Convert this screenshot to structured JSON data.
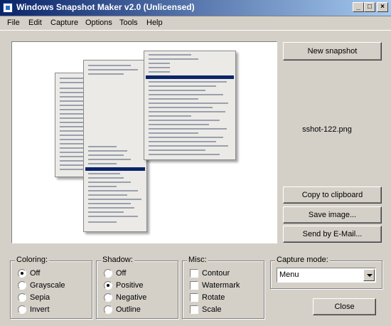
{
  "window": {
    "title": "Windows Snapshot Maker v2.0 (Unlicensed)"
  },
  "menu": [
    "File",
    "Edit",
    "Capture",
    "Options",
    "Tools",
    "Help"
  ],
  "buttons": {
    "new_snapshot": "New snapshot",
    "copy": "Copy to clipboard",
    "save": "Save image...",
    "email": "Send by E-Mail...",
    "close": "Close"
  },
  "filename": "sshot-122.png",
  "coloring": {
    "label": "Coloring:",
    "options": [
      "Off",
      "Grayscale",
      "Sepia",
      "Invert"
    ],
    "selected": "Off"
  },
  "shadow": {
    "label": "Shadow:",
    "options": [
      "Off",
      "Positive",
      "Negative",
      "Outline"
    ],
    "selected": "Positive"
  },
  "misc": {
    "label": "Misc:",
    "options": [
      {
        "label": "Contour",
        "checked": false
      },
      {
        "label": "Watermark",
        "checked": false
      },
      {
        "label": "Rotate",
        "checked": false
      },
      {
        "label": "Scale",
        "checked": false
      }
    ]
  },
  "capture_mode": {
    "label": "Capture mode:",
    "value": "Menu"
  }
}
